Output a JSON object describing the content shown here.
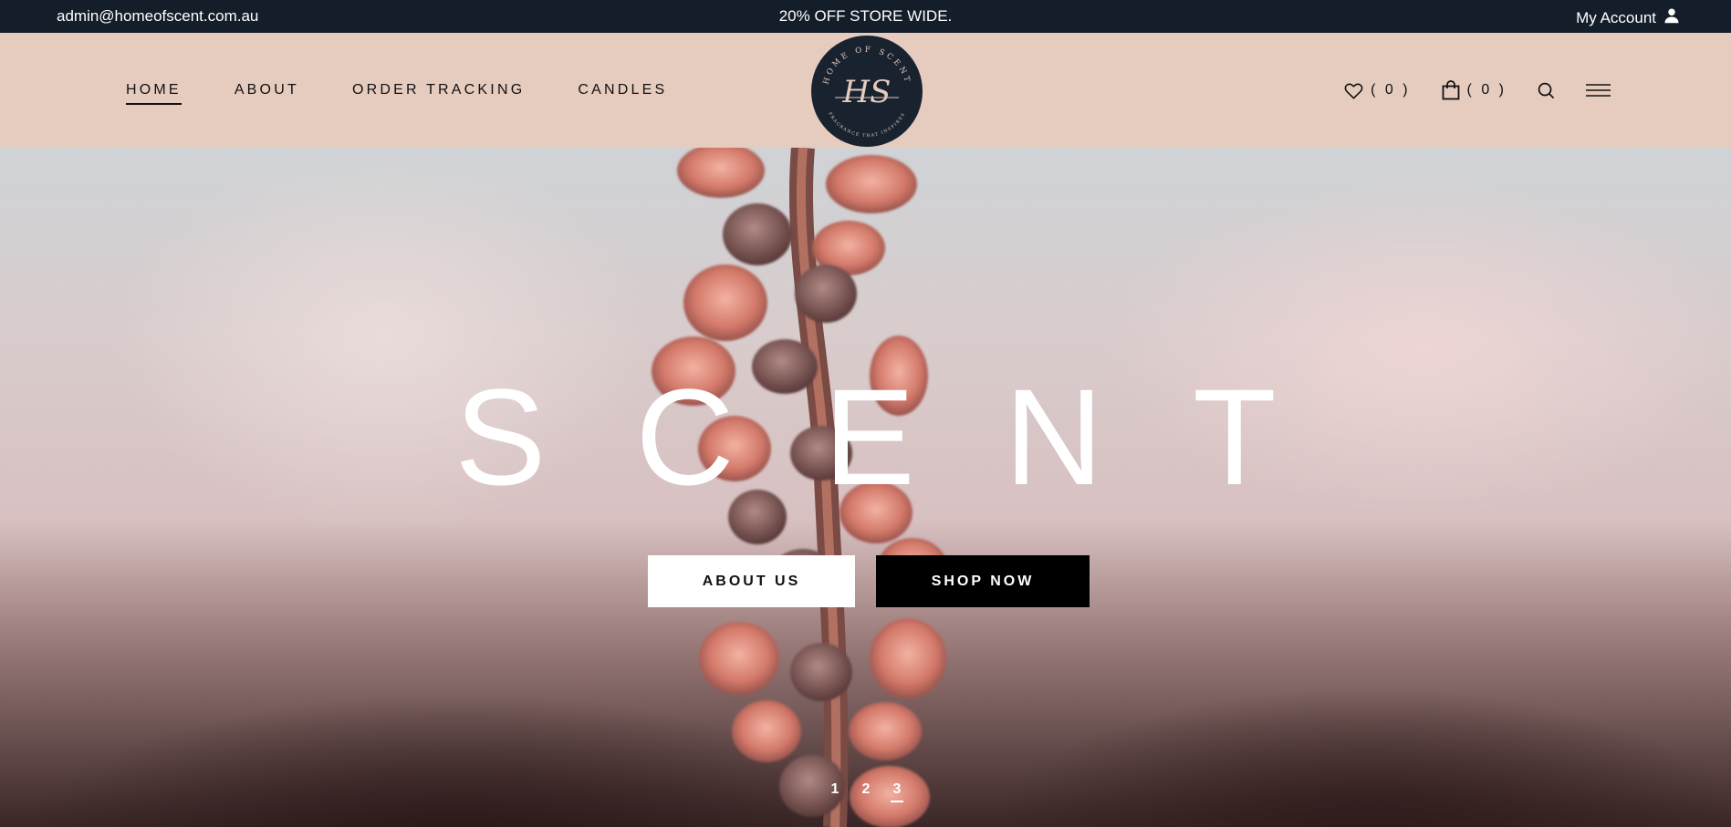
{
  "topbar": {
    "email": "admin@homeofscent.com.au",
    "promo": "20% OFF STORE WIDE.",
    "account_label": "My Account",
    "account_icon": "user-icon"
  },
  "nav": {
    "items": [
      {
        "label": "HOME",
        "active": true
      },
      {
        "label": "ABOUT"
      },
      {
        "label": "ORDER TRACKING"
      },
      {
        "label": "CANDLES"
      }
    ]
  },
  "logo": {
    "monogram": "HS",
    "arc_top": "HOME OF SCENT",
    "arc_bottom": "FRAGRANCE THAT INSPIRES"
  },
  "actions": {
    "wishlist_count": "( 0 )",
    "cart_count": "( 0 )",
    "wishlist_icon": "heart-icon",
    "cart_icon": "shopping-bag-icon",
    "search_icon": "search-icon",
    "menu_icon": "hamburger-menu-icon"
  },
  "hero": {
    "title": "SCENT",
    "about_button": "ABOUT US",
    "shop_button": "SHOP NOW",
    "slides": [
      "1",
      "2",
      "3"
    ],
    "active_slide": 3
  },
  "colors": {
    "topbar_bg": "#141e2a",
    "header_bg": "#e6cbbf",
    "logo_bg": "#18232f",
    "accent_black": "#000000",
    "white": "#ffffff"
  }
}
